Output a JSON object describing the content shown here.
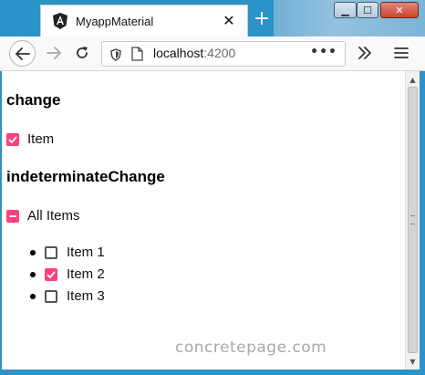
{
  "browser": {
    "tab_title": "MyappMaterial",
    "tab_close_glyph": "✕",
    "new_tab_glyph": "+",
    "url_host": "localhost",
    "url_port": ":4200",
    "url_menu_glyph": "•••",
    "window_min_glyph": "▁",
    "window_max_glyph": "☐",
    "window_close_glyph": "✕",
    "icons": {
      "favicon": "angular-icon",
      "back": "back-arrow-icon",
      "forward": "forward-arrow-icon",
      "reload": "reload-icon",
      "security": "shield-icon",
      "page": "page-icon",
      "overflow": "chevron-double-right-icon",
      "menu": "hamburger-menu-icon"
    }
  },
  "page": {
    "section_change": {
      "heading": "change",
      "item": {
        "label": "Item",
        "state": "checked"
      }
    },
    "section_indeterminate": {
      "heading": "indeterminateChange",
      "all_items": {
        "label": "All Items",
        "state": "indeterminate"
      },
      "items": [
        {
          "label": "Item 1",
          "state": "unchecked"
        },
        {
          "label": "Item 2",
          "state": "checked"
        },
        {
          "label": "Item 3",
          "state": "unchecked"
        }
      ]
    },
    "watermark": "concretepage.com"
  },
  "colors": {
    "accent": "#ff4081",
    "title_bar": "#2b93c8"
  }
}
